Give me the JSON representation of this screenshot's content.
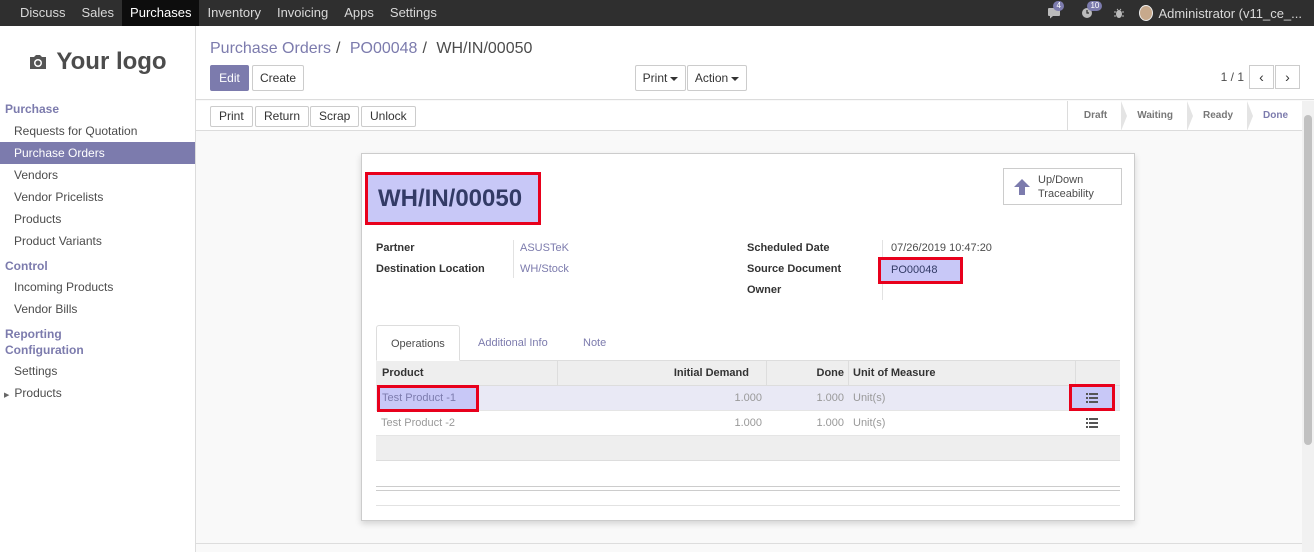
{
  "topnav": {
    "items": [
      "Discuss",
      "Sales",
      "Purchases",
      "Inventory",
      "Invoicing",
      "Apps",
      "Settings"
    ],
    "active": "Purchases",
    "messages_count": "4",
    "activities_count": "10",
    "user": "Administrator (v11_ce_..."
  },
  "sidebar": {
    "logo_text": "Your logo",
    "purchase_label": "Purchase",
    "purchase_items": [
      "Requests for Quotation",
      "Purchase Orders",
      "Vendors",
      "Vendor Pricelists",
      "Products",
      "Product Variants"
    ],
    "control_label": "Control",
    "control_items": [
      "Incoming Products",
      "Vendor Bills"
    ],
    "reporting_label": "Reporting",
    "configuration_label": "Configuration",
    "config_items": [
      "Settings",
      "Products"
    ]
  },
  "breadcrumb": {
    "root": "Purchase Orders",
    "parent": "PO00048",
    "current": "WH/IN/00050"
  },
  "controls": {
    "edit": "Edit",
    "create": "Create",
    "print": "Print",
    "action": "Action",
    "pager": "1 / 1"
  },
  "statusbar": {
    "buttons": [
      "Print",
      "Return",
      "Scrap",
      "Unlock"
    ],
    "stages": [
      "Draft",
      "Waiting",
      "Ready",
      "Done"
    ],
    "current_stage": "Done"
  },
  "record": {
    "name": "WH/IN/00050",
    "trace_button": [
      "Up/Down",
      "Traceability"
    ],
    "partner_label": "Partner",
    "partner": "ASUSTeK",
    "dest_label": "Destination Location",
    "dest": "WH/Stock",
    "sched_label": "Scheduled Date",
    "sched": "07/26/2019 10:47:20",
    "source_label": "Source Document",
    "source": "PO00048",
    "owner_label": "Owner",
    "owner": ""
  },
  "tabs": [
    "Operations",
    "Additional Info",
    "Note"
  ],
  "operations": {
    "columns": [
      "Product",
      "Initial Demand",
      "Done",
      "Unit of Measure"
    ],
    "rows": [
      {
        "product": "Test Product -1",
        "demand": "1.000",
        "done": "1.000",
        "uom": "Unit(s)"
      },
      {
        "product": "Test Product -2",
        "demand": "1.000",
        "done": "1.000",
        "uom": "Unit(s)"
      }
    ]
  }
}
